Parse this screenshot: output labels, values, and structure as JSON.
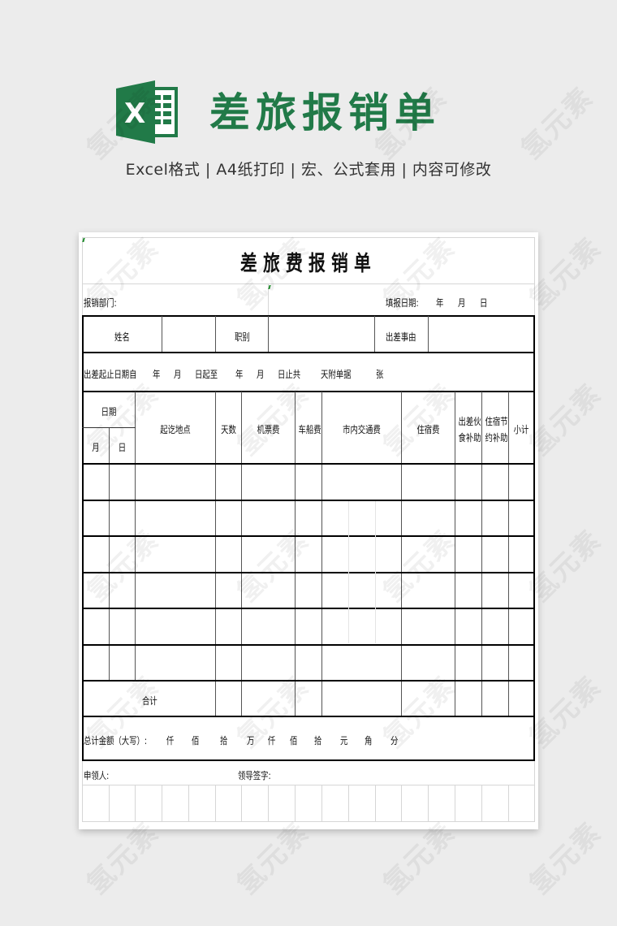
{
  "banner": {
    "logo_icon": "excel-logo-icon",
    "title": "差旅报销单",
    "subtitle": "Excel格式 |  A4纸打印 | 宏、公式套用 | 内容可修改"
  },
  "watermark": "氢元素",
  "colors": {
    "brand": "#217a48",
    "background": "#ececec"
  },
  "form": {
    "title": "差旅费报销单",
    "department_label": "报销部门:",
    "fill_date_label": "填报日期:",
    "year": "年",
    "month": "月",
    "day": "日",
    "name_label": "姓名",
    "position_label": "职别",
    "reason_label": "出差事由",
    "period": {
      "from_label": "出差起止日期自",
      "year1": "年",
      "month1": "月",
      "day_to": "日起至",
      "year2": "年",
      "month2": "月",
      "day_total": "日止共",
      "days_attach": "天附单据",
      "sheets": "张"
    },
    "columns": {
      "date": "日期",
      "month": "月",
      "day": "日",
      "route": "起讫地点",
      "days": "天数",
      "airfare": "机票费",
      "vehicle": "车船费",
      "local_transport": "市内交通费",
      "lodging": "住宿费",
      "meal_allowance_1": "出差伙",
      "meal_allowance_2": "食补助",
      "lodging_saving_1": "住宿节",
      "lodging_saving_2": "约补助",
      "subtotal": "小计"
    },
    "data_rows": 6,
    "total_label": "合计",
    "grand_total": {
      "label": "总计金额（大写）:",
      "units": [
        "仟",
        "佰",
        "拾",
        "万",
        "仟",
        "佰",
        "拾",
        "元",
        "角",
        "分"
      ]
    },
    "applicant_label": "申领人:",
    "leader_sign_label": "领导签字:"
  }
}
